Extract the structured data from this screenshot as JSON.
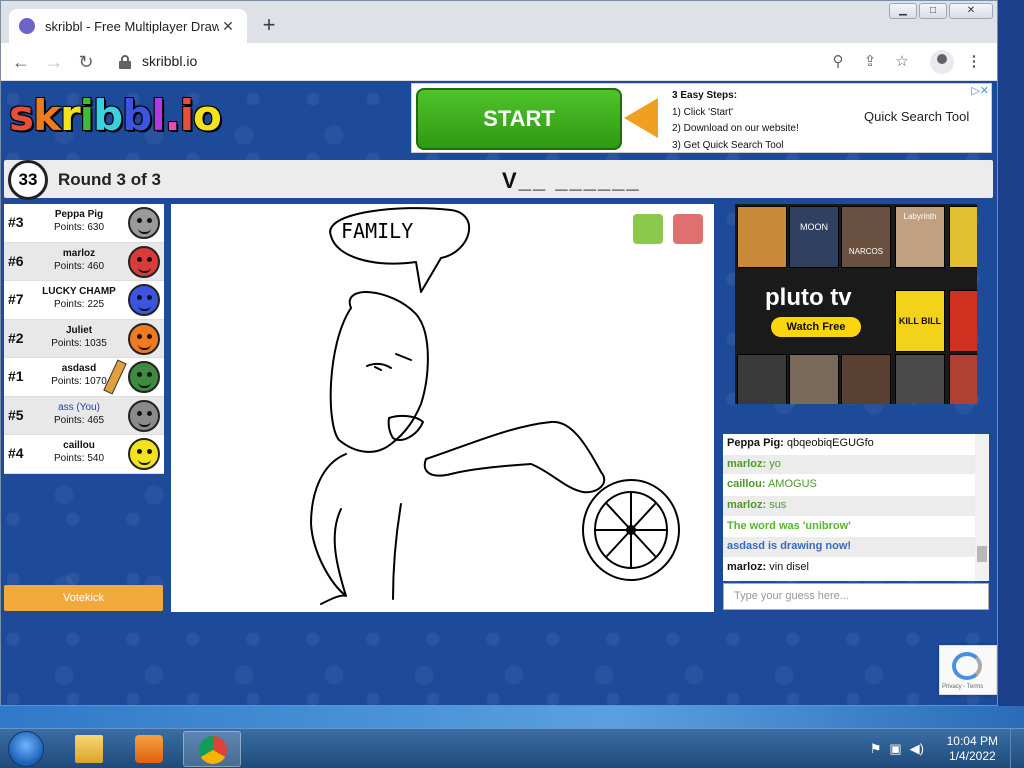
{
  "browser": {
    "tab_title": "skribbl - Free Multiplayer Drawin",
    "url": "skribbl.io",
    "new_tab": "+",
    "tab_close": "✕"
  },
  "logo": {
    "text": "skribbl.io"
  },
  "ad_top": {
    "start_label": "START",
    "steps_title": "3 Easy Steps:",
    "step1": "1) Click 'Start'",
    "step2": "2) Download on our website!",
    "step3": "3) Get Quick Search Tool",
    "product": "Quick Search Tool"
  },
  "game": {
    "timer": "33",
    "round": "Round 3 of 3",
    "word_hint": "V__ ______",
    "drawing_caption": "FAMILY"
  },
  "players": [
    {
      "rank": "#3",
      "name": "Peppa Pig",
      "points": "Points: 630",
      "color": "#9a9a9a"
    },
    {
      "rank": "#6",
      "name": "marloz",
      "points": "Points: 460",
      "color": "#d93a3a"
    },
    {
      "rank": "#7",
      "name": "LUCKY CHAMP",
      "points": "Points: 225",
      "color": "#3b55e0"
    },
    {
      "rank": "#2",
      "name": "Juliet",
      "points": "Points: 1035",
      "color": "#f07a20"
    },
    {
      "rank": "#1",
      "name": "asdasd",
      "points": "Points: 1070",
      "color": "#3e8a3e"
    },
    {
      "rank": "#5",
      "name": "ass (You)",
      "points": "Points: 465",
      "color": "#8a8a8a"
    },
    {
      "rank": "#4",
      "name": "caillou",
      "points": "Points: 540",
      "color": "#f3e31c"
    }
  ],
  "votekick": "Votekick",
  "ad_side": {
    "brand": "pluto tv",
    "cta": "Watch Free",
    "poster1": "MOON",
    "poster2": "NARCOS",
    "poster3": "Labyrinth",
    "poster4": "KILL BILL"
  },
  "chat": [
    {
      "user": "Peppa Pig:",
      "text": "qbqeobiqEGUGfo",
      "style": "normal"
    },
    {
      "user": "marloz:",
      "text": "yo",
      "style": "green"
    },
    {
      "user": "caillou:",
      "text": "AMOGUS",
      "style": "green"
    },
    {
      "user": "marloz:",
      "text": "sus",
      "style": "green"
    },
    {
      "user": "",
      "text": "The word was 'unibrow'",
      "style": "greenbold"
    },
    {
      "user": "",
      "text": "asdasd is drawing now!",
      "style": "blue"
    },
    {
      "user": "marloz:",
      "text": "vin disel",
      "style": "normal"
    }
  ],
  "guess_placeholder": "Type your guess here...",
  "recaptcha_text": "Privacy - Terms",
  "taskbar": {
    "time": "10:04 PM",
    "date": "1/4/2022"
  }
}
